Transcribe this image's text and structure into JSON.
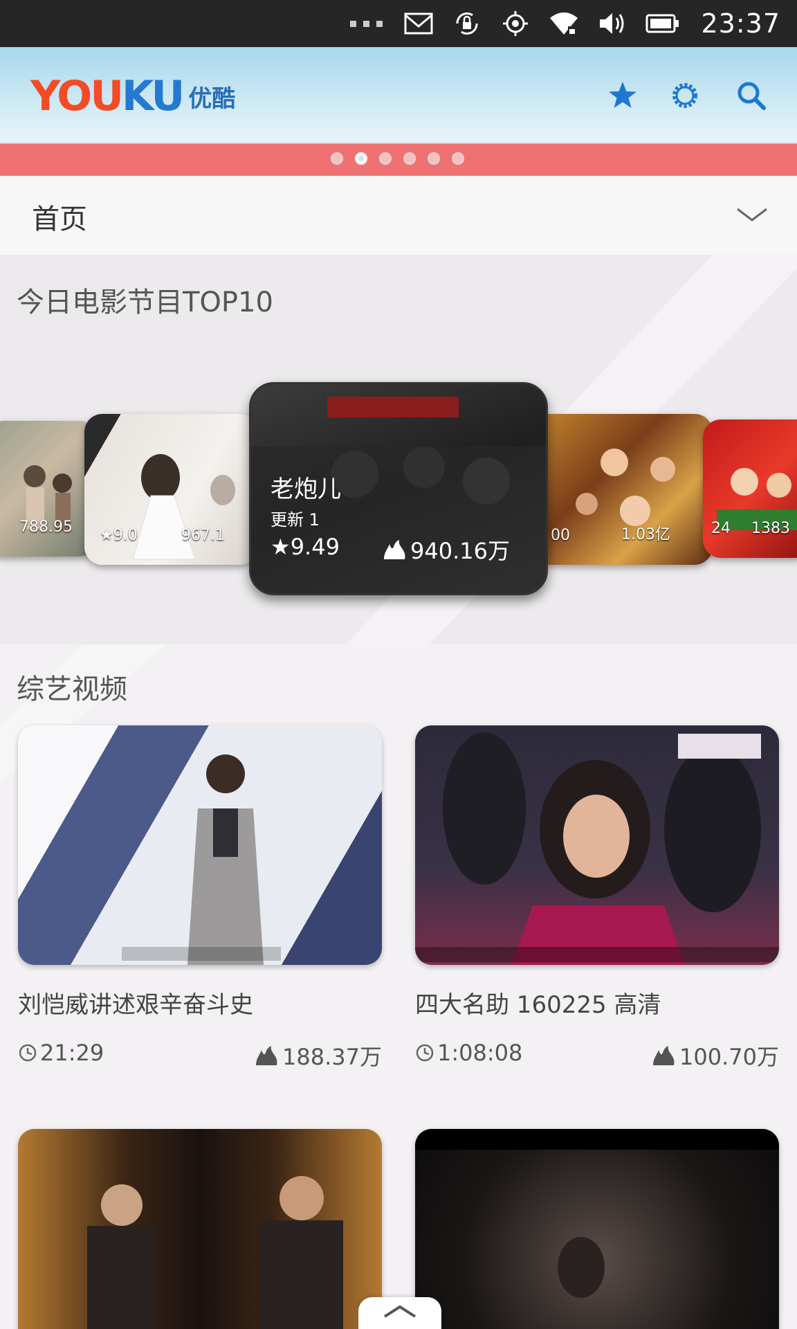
{
  "status_bar": {
    "time": "23:37",
    "icons": [
      "overflow-dots-icon",
      "mail-icon",
      "screen-rotation-lock-icon",
      "location-icon",
      "wifi-icon",
      "volume-icon",
      "battery-icon"
    ]
  },
  "header": {
    "logo_en": "YOUKU",
    "logo_cn": "优酷",
    "actions": [
      "star-icon",
      "settings-gear-icon",
      "search-icon"
    ],
    "accent_color": "#1e78d2"
  },
  "banner": {
    "pages": 6,
    "active_index": 1,
    "color": "#f07171"
  },
  "category": {
    "label": "首页"
  },
  "top10": {
    "title": "今日电影节目TOP10",
    "featured": {
      "title": "老炮儿",
      "update": "更新 1",
      "rating": "★9.49",
      "views": "940.16万"
    },
    "side_posters": [
      {
        "meta_text": "788.95"
      },
      {
        "meta_rating": "★9.0",
        "meta_text": "967.1"
      },
      {
        "meta_text": "00"
      },
      {
        "meta_text": "1.03亿"
      },
      {
        "meta_text": "24"
      },
      {
        "meta_text": "1383"
      }
    ]
  },
  "variety": {
    "title": "综艺视频",
    "cards": [
      {
        "title": "刘恺威讲述艰辛奋斗史",
        "duration": "21:29",
        "views": "188.37万"
      },
      {
        "title": "四大名助 160225 高清",
        "duration": "1:08:08",
        "views": "100.70万"
      },
      {
        "title": "",
        "duration": "",
        "views": ""
      },
      {
        "title": "",
        "duration": "",
        "views": ""
      }
    ]
  }
}
